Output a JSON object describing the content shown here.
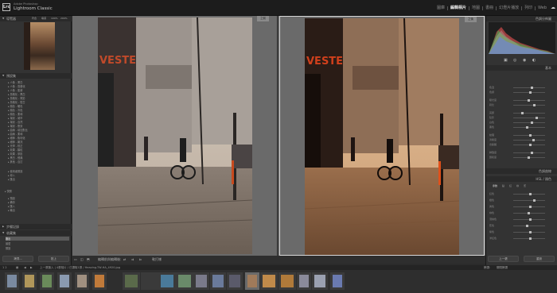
{
  "app": {
    "brand_small": "Adobe Photoshop",
    "brand_big": "Lightroom Classic",
    "logo": "Lrc"
  },
  "modules": [
    "圖庫",
    "編輯相片",
    "地圖",
    "書冊",
    "幻燈片播放",
    "列印",
    "Web"
  ],
  "left_panel": {
    "navigator_title": "導覽器",
    "navigator_zoom": [
      "符合",
      "填滿",
      "100%",
      "200%"
    ],
    "presets_title": "預設集",
    "preset_items": [
      "人像 - 黑白",
      "人像 - 風格化",
      "人像 - 肌膚",
      "風格化 - 黑白",
      "風格化 - 電影",
      "風格化 - 復古",
      "顏色 - 暖色",
      "顏色 - 冷色",
      "顏色 - 柔和",
      "場景 - 城市",
      "場景 - 自然",
      "場景 - 夜景",
      "曲線 - 增加對比",
      "曲線 - 柔和",
      "細節 - 銳利化",
      "細節 - 雜訊",
      "光學 - 校正",
      "效果 - 顆粒",
      "效果 - 暈影",
      "黑白 - 經典",
      "其他 - 自訂"
    ],
    "user_presets": [
      "使用者預設",
      "導入",
      "匯出"
    ],
    "group2_title": "快照",
    "group2_items": [
      "預設",
      "備份",
      "匯入",
      "輸出"
    ],
    "history_title": "步驟記錄",
    "collections_title": "收藏集",
    "collection_items": [
      "匯出",
      "最愛",
      "預設"
    ],
    "btn_copy": "拷貝...",
    "btn_paste": "貼上"
  },
  "center": {
    "label_before": "之前",
    "label_after": "之後",
    "toolbar_text": "編輯前與編輯後:",
    "toolbar_soft": "軟打樣"
  },
  "right_panel": {
    "histogram_title": "色調分佈圖",
    "basic_title": "基本",
    "tone_curve_title": "色調曲線",
    "hsl_title": "HSL / 顏色",
    "sliders": [
      "色溫",
      "色調",
      "曝光度",
      "對比",
      "亮部",
      "陰影",
      "白色",
      "黑色",
      "紋理",
      "清晰度",
      "去朦朧",
      "鮮豔度",
      "飽和度"
    ],
    "curve_tabs": [
      "參數",
      "點",
      "紅",
      "綠",
      "藍"
    ],
    "hsl_rows": [
      "紅色",
      "橙色",
      "黃色",
      "綠色",
      "淺綠色",
      "藍色",
      "紫色",
      "洋紅色"
    ],
    "btn_prev": "上一張",
    "btn_reset": "重設"
  },
  "filmbar": {
    "page": "1 2",
    "source": "上一張匯入 | 4張相片 / 已選取1張 / Heaving-TW-HA_4920.jpg",
    "filter": "篩選:",
    "filter_value": "關閉篩選"
  },
  "filmstrip": {
    "count": 20,
    "selected_index": 13
  }
}
